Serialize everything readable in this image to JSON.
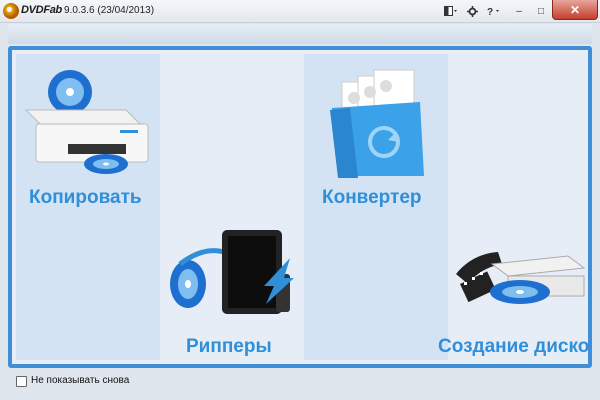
{
  "titlebar": {
    "brand": "DVDFab",
    "version": "9.0.3.6 (23/04/2013)",
    "minimize_glyph": "–",
    "maximize_glyph": "□",
    "close_glyph": "✕"
  },
  "tiles": [
    {
      "label": "Копировать",
      "icon": "copy-printer-icon"
    },
    {
      "label": "Рипперы",
      "icon": "ripper-tablet-icon"
    },
    {
      "label": "Конвертер",
      "icon": "converter-folder-icon"
    },
    {
      "label": "Создание дисков",
      "icon": "disc-creator-drive-icon"
    }
  ],
  "footer": {
    "dont_show_label": "Не показывать снова"
  },
  "colors": {
    "accent": "#3f8fd8",
    "tile_label": "#2f8fd9",
    "close": "#c2402e"
  }
}
